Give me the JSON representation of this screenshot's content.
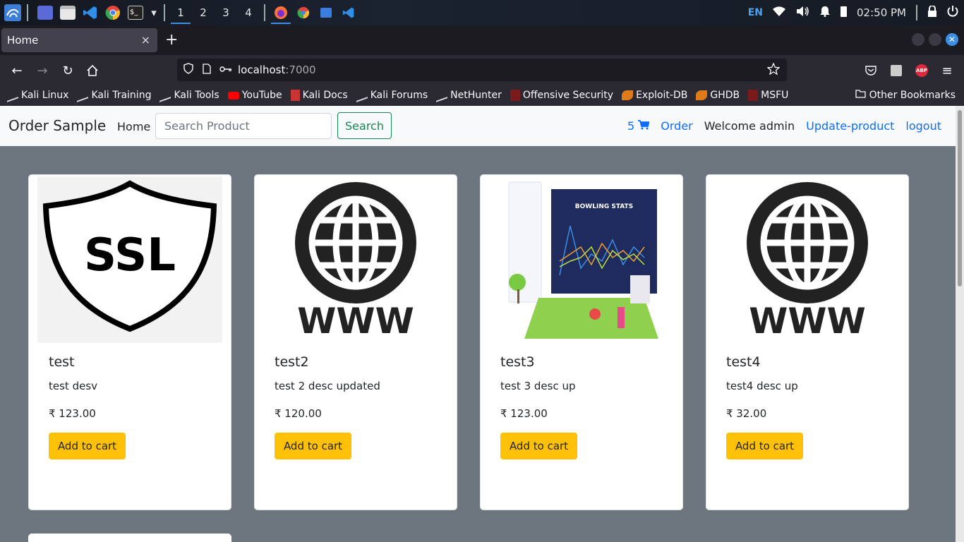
{
  "taskbar": {
    "workspaces": [
      "1",
      "2",
      "3",
      "4"
    ],
    "active_workspace": "1",
    "language": "EN",
    "clock": "02:50 PM"
  },
  "browser": {
    "tab_title": "Home",
    "tab_close": "×",
    "new_tab": "+",
    "url_host": "localhost",
    "url_port": ":7000"
  },
  "bookmarks": {
    "items": [
      "Kali Linux",
      "Kali Training",
      "Kali Tools",
      "YouTube",
      "Kali Docs",
      "Kali Forums",
      "NetHunter",
      "Offensive Security",
      "Exploit-DB",
      "GHDB",
      "MSFU"
    ],
    "other": "Other Bookmarks"
  },
  "site": {
    "brand": "Order Sample",
    "home": "Home",
    "search_placeholder": "Search Product",
    "search_button": "Search",
    "cart_count": "5",
    "order": "Order",
    "welcome": "Welcome admin",
    "update_product": "Update-product",
    "logout": "logout"
  },
  "products": [
    {
      "title": "test",
      "desc": "test desv",
      "price": "₹ 123.00",
      "button": "Add to cart",
      "image": "ssl-shield-icon"
    },
    {
      "title": "test2",
      "desc": "test 2 desc updated",
      "price": "₹ 120.00",
      "button": "Add to cart",
      "image": "www-globe-icon"
    },
    {
      "title": "test3",
      "desc": "test 3 desc up",
      "price": "₹ 123.00",
      "button": "Add to cart",
      "image": "bowling-stats-illustration"
    },
    {
      "title": "test4",
      "desc": "test4 desc up",
      "price": "₹ 32.00",
      "button": "Add to cart",
      "image": "www-globe-icon"
    }
  ],
  "image_text": {
    "ssl": "SSL",
    "www": "WWW",
    "bowling": "BOWLING STATS"
  },
  "colors": {
    "brand_green": "#198754",
    "link_blue": "#0d6efd",
    "cart_yellow": "#ffc107",
    "page_bg": "#6c757d"
  }
}
